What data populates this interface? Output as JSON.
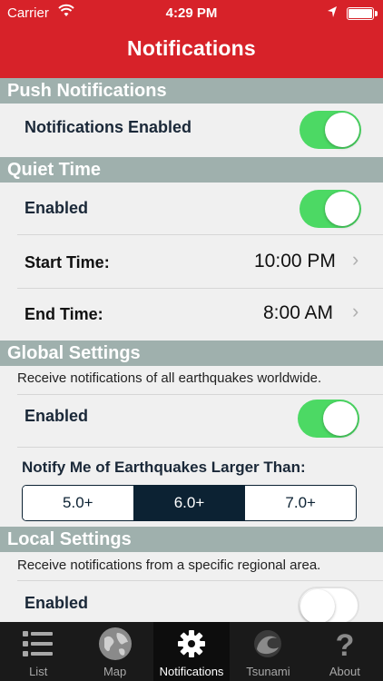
{
  "status": {
    "carrier": "Carrier",
    "time": "4:29 PM"
  },
  "header": {
    "title": "Notifications"
  },
  "push": {
    "header": "Push Notifications",
    "enabled_label": "Notifications Enabled",
    "enabled": true
  },
  "quiet": {
    "header": "Quiet Time",
    "enabled_label": "Enabled",
    "enabled": true,
    "start_label": "Start Time:",
    "start_value": "10:00 PM",
    "end_label": "End Time:",
    "end_value": "8:00 AM"
  },
  "global": {
    "header": "Global Settings",
    "description": "Receive notifications of all earthquakes worldwide.",
    "enabled_label": "Enabled",
    "enabled": true,
    "threshold_label": "Notify Me of Earthquakes Larger Than:",
    "options": [
      "5.0+",
      "6.0+",
      "7.0+"
    ],
    "selected": "6.0+"
  },
  "local": {
    "header": "Local Settings",
    "description": "Receive notifications from a specific regional area.",
    "enabled_label": "Enabled",
    "enabled": false
  },
  "tabs": [
    {
      "label": "List",
      "icon": "list-icon",
      "active": false
    },
    {
      "label": "Map",
      "icon": "globe-icon",
      "active": false
    },
    {
      "label": "Notifications",
      "icon": "gear-icon",
      "active": true
    },
    {
      "label": "Tsunami",
      "icon": "wave-icon",
      "active": false
    },
    {
      "label": "About",
      "icon": "question-icon",
      "active": false
    }
  ],
  "colors": {
    "header": "#d72229",
    "section": "#9fb0ad",
    "toggle_on": "#4cd964",
    "navy": "#0c2233"
  }
}
